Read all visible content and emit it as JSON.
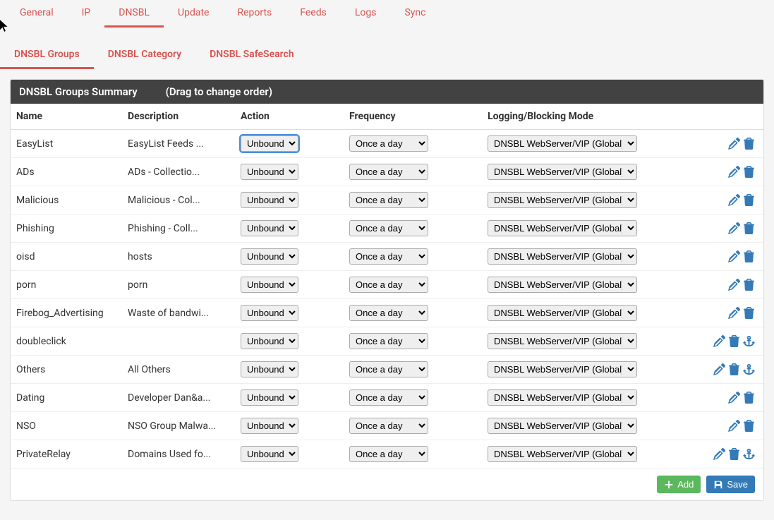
{
  "mainTabs": [
    "General",
    "IP",
    "DNSBL",
    "Update",
    "Reports",
    "Feeds",
    "Logs",
    "Sync"
  ],
  "activeMainTab": 2,
  "subTabs": [
    "DNSBL Groups",
    "DNSBL Category",
    "DNSBL SafeSearch"
  ],
  "activeSubTab": 0,
  "panel": {
    "title": "DNSBL Groups Summary",
    "hint": "(Drag to change order)"
  },
  "columns": {
    "name": "Name",
    "description": "Description",
    "action": "Action",
    "frequency": "Frequency",
    "mode": "Logging/Blocking Mode"
  },
  "options": {
    "action": [
      "Unbound"
    ],
    "frequency": [
      "Once a day"
    ],
    "mode": [
      "DNSBL WebServer/VIP (Global)"
    ]
  },
  "rows": [
    {
      "name": "EasyList",
      "desc": "EasyList Feeds ...",
      "action": "Unbound",
      "freq": "Once a day",
      "mode": "DNSBL WebServer/VIP (Global)",
      "anchor": false,
      "focused": true
    },
    {
      "name": "ADs",
      "desc": "ADs - Collectio...",
      "action": "Unbound",
      "freq": "Once a day",
      "mode": "DNSBL WebServer/VIP (Global)",
      "anchor": false
    },
    {
      "name": "Malicious",
      "desc": "Malicious - Col...",
      "action": "Unbound",
      "freq": "Once a day",
      "mode": "DNSBL WebServer/VIP (Global)",
      "anchor": false
    },
    {
      "name": "Phishing",
      "desc": "Phishing - Coll...",
      "action": "Unbound",
      "freq": "Once a day",
      "mode": "DNSBL WebServer/VIP (Global)",
      "anchor": false
    },
    {
      "name": "oisd",
      "desc": "hosts",
      "action": "Unbound",
      "freq": "Once a day",
      "mode": "DNSBL WebServer/VIP (Global)",
      "anchor": false
    },
    {
      "name": "porn",
      "desc": "porn",
      "action": "Unbound",
      "freq": "Once a day",
      "mode": "DNSBL WebServer/VIP (Global)",
      "anchor": false
    },
    {
      "name": "Firebog_Advertising",
      "desc": "Waste of bandwi...",
      "action": "Unbound",
      "freq": "Once a day",
      "mode": "DNSBL WebServer/VIP (Global)",
      "anchor": false
    },
    {
      "name": "doubleclick",
      "desc": "",
      "action": "Unbound",
      "freq": "Once a day",
      "mode": "DNSBL WebServer/VIP (Global)",
      "anchor": true
    },
    {
      "name": "Others",
      "desc": "All Others",
      "action": "Unbound",
      "freq": "Once a day",
      "mode": "DNSBL WebServer/VIP (Global)",
      "anchor": true
    },
    {
      "name": "Dating",
      "desc": "Developer Dan&a...",
      "action": "Unbound",
      "freq": "Once a day",
      "mode": "DNSBL WebServer/VIP (Global)",
      "anchor": false
    },
    {
      "name": "NSO",
      "desc": "NSO Group Malwa...",
      "action": "Unbound",
      "freq": "Once a day",
      "mode": "DNSBL WebServer/VIP (Global)",
      "anchor": false
    },
    {
      "name": "PrivateRelay",
      "desc": "Domains Used fo...",
      "action": "Unbound",
      "freq": "Once a day",
      "mode": "DNSBL WebServer/VIP (Global)",
      "anchor": true
    }
  ],
  "buttons": {
    "add": "Add",
    "save": "Save"
  }
}
